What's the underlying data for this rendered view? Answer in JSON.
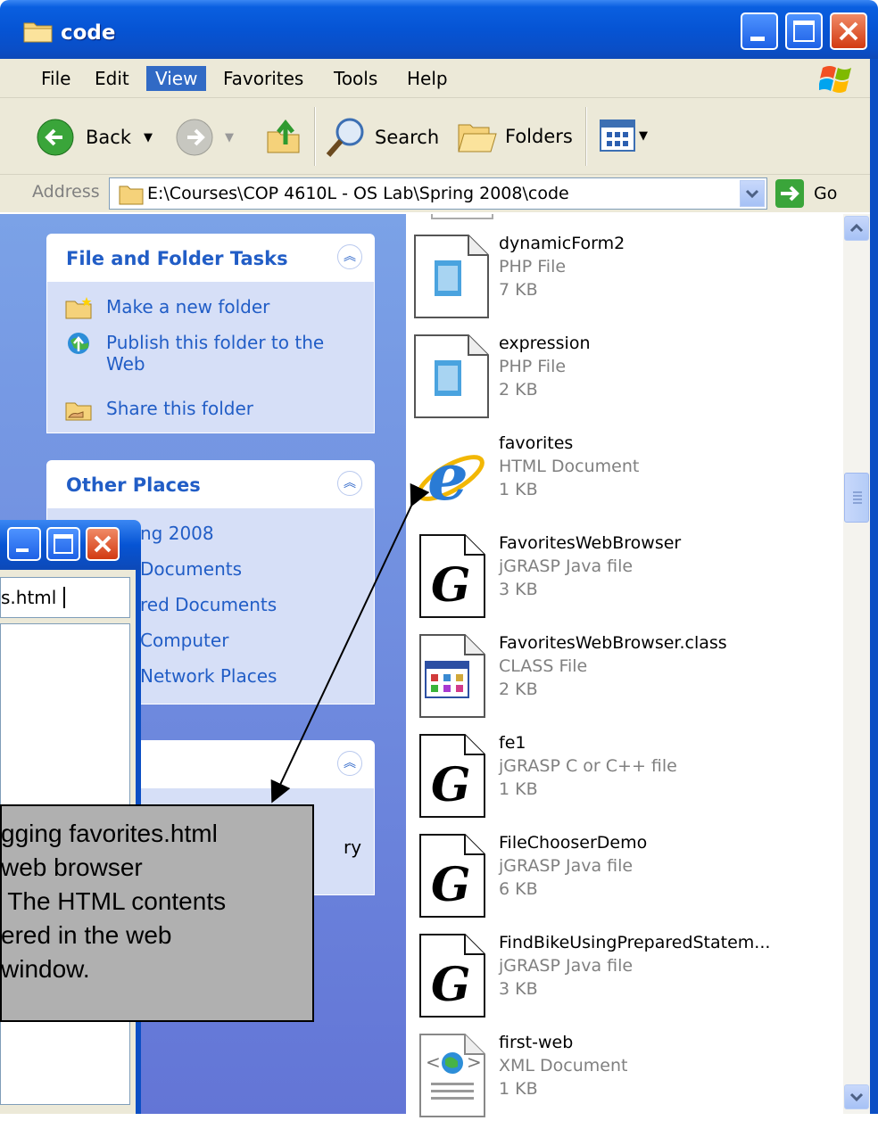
{
  "window": {
    "title": "code"
  },
  "menubar": {
    "items": [
      "File",
      "Edit",
      "View",
      "Favorites",
      "Tools",
      "Help"
    ],
    "active": "View"
  },
  "toolbar": {
    "back_label": "Back",
    "search_label": "Search",
    "folders_label": "Folders"
  },
  "address": {
    "label": "Address",
    "value": "E:\\Courses\\COP 4610L - OS Lab\\Spring 2008\\code",
    "go_label": "Go"
  },
  "tasks": {
    "title": "File and Folder Tasks",
    "items": [
      {
        "label": "Make a new folder",
        "icon": "new-folder-icon"
      },
      {
        "label": "Publish this folder to the Web",
        "icon": "publish-web-icon"
      },
      {
        "label": "Share this folder",
        "icon": "share-folder-icon"
      }
    ]
  },
  "other_places": {
    "title": "Other Places",
    "items": [
      "ng 2008",
      "Documents",
      "red Documents",
      "Computer",
      "Network Places"
    ]
  },
  "details": {
    "partial_text": "ry"
  },
  "files": [
    {
      "name": "dynamicForm2",
      "type": "PHP File",
      "size": "7 KB",
      "icon": "php-file-icon"
    },
    {
      "name": "expression",
      "type": "PHP File",
      "size": "2 KB",
      "icon": "php-file-icon"
    },
    {
      "name": "favorites",
      "type": "HTML Document",
      "size": "1 KB",
      "icon": "internet-explorer-icon"
    },
    {
      "name": "FavoritesWebBrowser",
      "type": "jGRASP Java file",
      "size": "3 KB",
      "icon": "jgrasp-file-icon"
    },
    {
      "name": "FavoritesWebBrowser.class",
      "type": "CLASS File",
      "size": "2 KB",
      "icon": "class-file-icon"
    },
    {
      "name": "fe1",
      "type": "jGRASP C or C++ file",
      "size": "1 KB",
      "icon": "jgrasp-file-icon"
    },
    {
      "name": "FileChooserDemo",
      "type": "jGRASP Java file",
      "size": "6 KB",
      "icon": "jgrasp-file-icon"
    },
    {
      "name": "FindBikeUsingPreparedStatem...",
      "type": "jGRASP Java file",
      "size": "3 KB",
      "icon": "jgrasp-file-icon"
    },
    {
      "name": "first-web",
      "type": "XML Document",
      "size": "1 KB",
      "icon": "xml-file-icon"
    }
  ],
  "browser_window": {
    "field_text": "s.html"
  },
  "callout": {
    "text": "gging favorites.html\nweb browser\n The HTML contents\nered in the web\nwindow."
  },
  "colors": {
    "title_blue": "#0654d4",
    "task_blue": "#215dc6",
    "callout_gray": "#b0b0b0"
  }
}
